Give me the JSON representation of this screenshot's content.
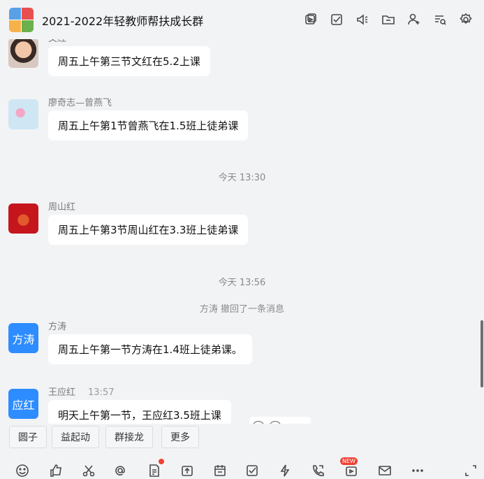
{
  "header": {
    "title": "2021-2022年轻教师帮扶成长群",
    "icons": [
      "video-icon",
      "task-icon",
      "announce-icon",
      "folder-icon",
      "add-member-icon",
      "search-history-icon",
      "settings-icon"
    ]
  },
  "messages": [
    {
      "sender": "文红",
      "text": "周五上午第三节文红在5.2上课"
    },
    {
      "sender": "廖奇志—曾燕飞",
      "text": "周五上午第1节曾燕飞在1.5班上徒弟课"
    },
    {
      "sender": "周山红",
      "text": "周五上午第3节周山红在3.3班上徒弟课"
    },
    {
      "sender": "方涛",
      "avatar_text": "方涛",
      "text": "周五上午第一节方涛在1.4班上徒弟课。"
    },
    {
      "sender": "王应红",
      "time": "13:57",
      "avatar_text": "应红",
      "text": "明天上午第一节，王应红3.5班上课"
    }
  ],
  "system": {
    "time1": "今天 13:30",
    "time2": "今天 13:56",
    "recall": "方涛 撤回了一条消息"
  },
  "quick_tags": [
    "圆子",
    "益起动",
    "群接龙",
    "更多"
  ],
  "toolbar": {
    "icons": [
      "emoji-icon",
      "like-icon",
      "scissors-icon",
      "at-icon",
      "doc-icon",
      "upload-icon",
      "calendar-icon",
      "check-icon",
      "lightning-icon",
      "call-icon",
      "live-icon",
      "mail-icon",
      "more-icon",
      "expand-icon"
    ],
    "new_badge": "NEW"
  },
  "colors": {
    "accent": "#2d8cff",
    "background": "#f2f3f5",
    "badge": "#f04134"
  }
}
